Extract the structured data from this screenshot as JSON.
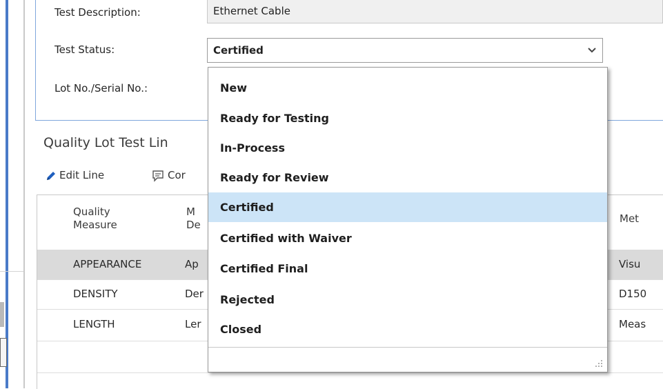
{
  "header_fields": {
    "test_description_label": "Test Description:",
    "test_description_value": "Ethernet Cable",
    "test_status_label": "Test Status:",
    "test_status_value": "Certified",
    "lot_serial_label": "Lot No./Serial No.:"
  },
  "section": {
    "title": "Quality Lot Test Lin"
  },
  "toolbar": {
    "edit_line_label": "Edit Line",
    "comments_label": "Cor"
  },
  "grid": {
    "columns": [
      {
        "line1": "Quality",
        "line2": "Measure"
      },
      {
        "line1": "M",
        "line2": "De"
      },
      {
        "line1": "Met",
        "line2": ""
      }
    ],
    "rows": [
      {
        "measure": "APPEARANCE",
        "desc": "Ap",
        "method": "Visu"
      },
      {
        "measure": "DENSITY",
        "desc": "Der",
        "method": "D150"
      },
      {
        "measure": "LENGTH",
        "desc": "Ler",
        "method": "Meas"
      }
    ]
  },
  "status_dropdown": {
    "options": [
      "New",
      "Ready for Testing",
      "In-Process",
      "Ready for Review",
      "Certified",
      "Certified with Waiver",
      "Certified Final",
      "Rejected",
      "Closed"
    ],
    "selected": "Certified"
  },
  "colors": {
    "panel_border": "#7fa6dc",
    "selected_option_bg": "#cce4f7",
    "selected_row_bg": "#dadada",
    "edit_icon": "#1f5fbf"
  },
  "icons": {
    "edit": "pencil-icon",
    "comments": "comment-icon",
    "dropdown": "chevron-down-icon",
    "resize": "resize-grip-icon"
  }
}
